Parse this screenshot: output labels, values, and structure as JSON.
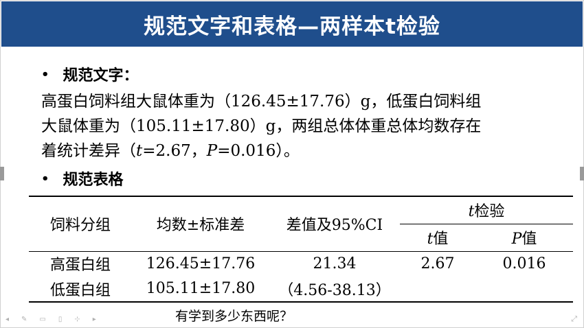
{
  "slide": {
    "title": "规范文字和表格—两样本t检验"
  },
  "section1": {
    "bullet": "•",
    "heading": "规范文字："
  },
  "paragraph": {
    "line1": "高蛋白饲料组大鼠体重为（126.45±17.76）g，低蛋白饲料组",
    "line2": "大鼠体重为（105.11±17.80）g，两组总体体重总体均数存在",
    "line3_pre": "着统计差异（",
    "t_symbol": "t",
    "line3_mid": "=2.67，",
    "p_symbol": "P",
    "line3_post": "=0.016）。"
  },
  "section2": {
    "bullet": "•",
    "heading": "规范表格"
  },
  "table": {
    "headers": {
      "group": "饲料分组",
      "mean_sd": "均数±标准差",
      "diff_ci": "差值及95%CI",
      "test_t": "t",
      "test_label": "检验",
      "t_value_sym": "t",
      "t_value_label": "值",
      "p_value_sym": "P",
      "p_value_label": "值"
    },
    "rows": [
      {
        "group": "高蛋白组",
        "mean_sd": "126.45±17.76",
        "diff_ci": "21.34",
        "t": "2.67",
        "p": "0.016"
      },
      {
        "group": "低蛋白组",
        "mean_sd": "105.11±17.80",
        "diff_ci": "（4.56-38.13）",
        "t": "",
        "p": ""
      }
    ]
  },
  "footer": {
    "question": "有学到多少东西呢？"
  },
  "colors": {
    "title_bar": "#1f4e8c"
  }
}
